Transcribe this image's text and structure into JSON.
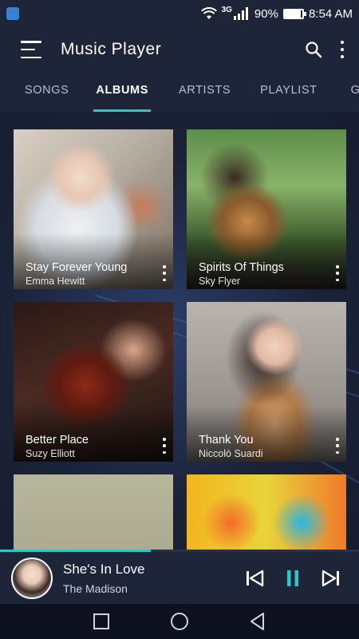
{
  "status_bar": {
    "network": "3G",
    "battery": "90%",
    "battery_level": 0.9,
    "time": "8:54 AM"
  },
  "toolbar": {
    "title": "Music Player"
  },
  "tabs": [
    {
      "label": "SONGS",
      "active": false
    },
    {
      "label": "ALBUMS",
      "active": true
    },
    {
      "label": "ARTISTS",
      "active": false
    },
    {
      "label": "PLAYLIST",
      "active": false
    },
    {
      "label": "GEN",
      "active": false
    }
  ],
  "albums": [
    {
      "title": "Stay Forever Young",
      "artist": "Emma Hewitt"
    },
    {
      "title": "Spirits Of Things",
      "artist": "Sky Flyer"
    },
    {
      "title": "Better Place",
      "artist": "Suzy Elliott"
    },
    {
      "title": "Thank You",
      "artist": "Niccolò Suardi"
    },
    {
      "title": "",
      "artist": ""
    },
    {
      "title": "",
      "artist": ""
    }
  ],
  "now_playing": {
    "title": "She's In Love",
    "artist": "The Madison",
    "progress": 0.42
  },
  "colors": {
    "accent": "#2ec7c9",
    "background": "#1b2236",
    "bar": "#1f2538"
  }
}
